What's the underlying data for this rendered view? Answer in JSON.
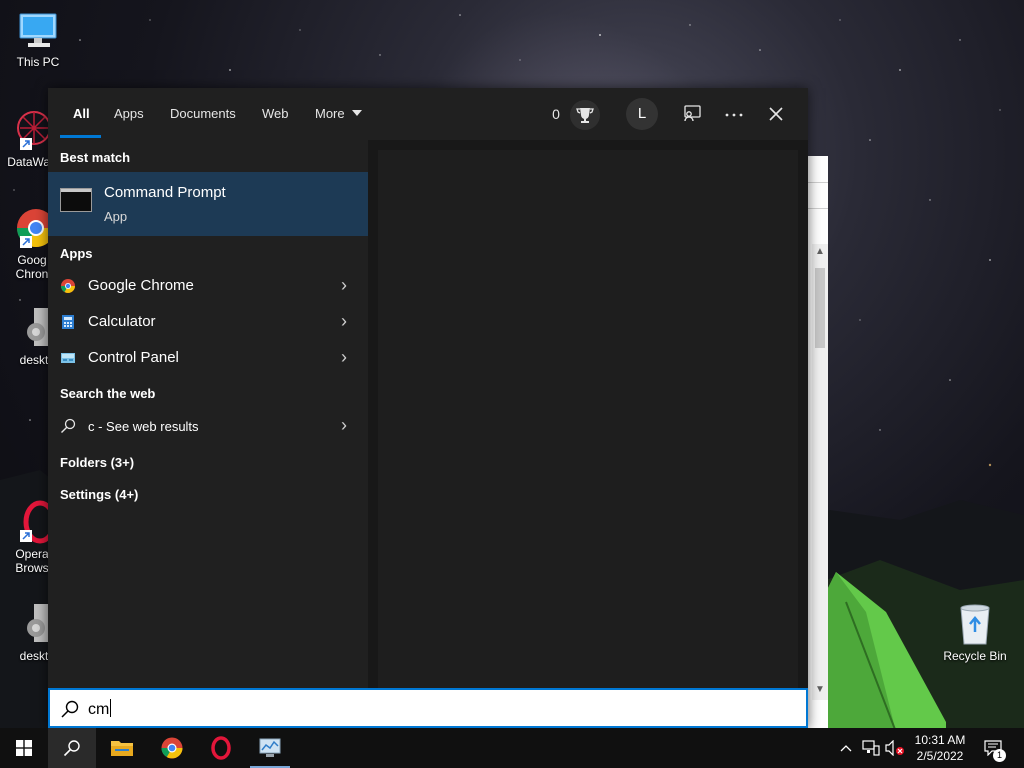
{
  "desktop": {
    "icons": {
      "this_pc": "This PC",
      "datawag": "DataWag",
      "chrome_line1": "Goog",
      "chrome_line2": "Chron",
      "desktop1": "deskt",
      "opera_line1": "Opera",
      "opera_line2": "Brows",
      "desktop2": "deskt",
      "recycle_bin": "Recycle Bin"
    }
  },
  "search_panel": {
    "tabs": [
      {
        "label": "All",
        "active": true
      },
      {
        "label": "Apps"
      },
      {
        "label": "Documents"
      },
      {
        "label": "Web"
      },
      {
        "label": "More"
      }
    ],
    "rewards_count": "0",
    "user_initial": "L",
    "best_match": {
      "header": "Best match",
      "title": "Command Prompt",
      "subtitle": "App"
    },
    "apps": {
      "header": "Apps",
      "items": [
        {
          "label": "Google Chrome",
          "icon": "chrome-icon"
        },
        {
          "label": "Calculator",
          "icon": "calculator-icon"
        },
        {
          "label": "Control Panel",
          "icon": "control-panel-icon"
        }
      ]
    },
    "web": {
      "header": "Search the web",
      "query": "c",
      "suffix": " - See web results"
    },
    "folders": "Folders (3+)",
    "settings": "Settings (4+)",
    "search_value": "cm"
  },
  "taskbar": {
    "time": "10:31 AM",
    "date": "2/5/2022",
    "notification_count": "1"
  },
  "colors": {
    "accent": "#0078d4",
    "panel_bg": "#202020",
    "selected_bg": "#1d3a55"
  }
}
